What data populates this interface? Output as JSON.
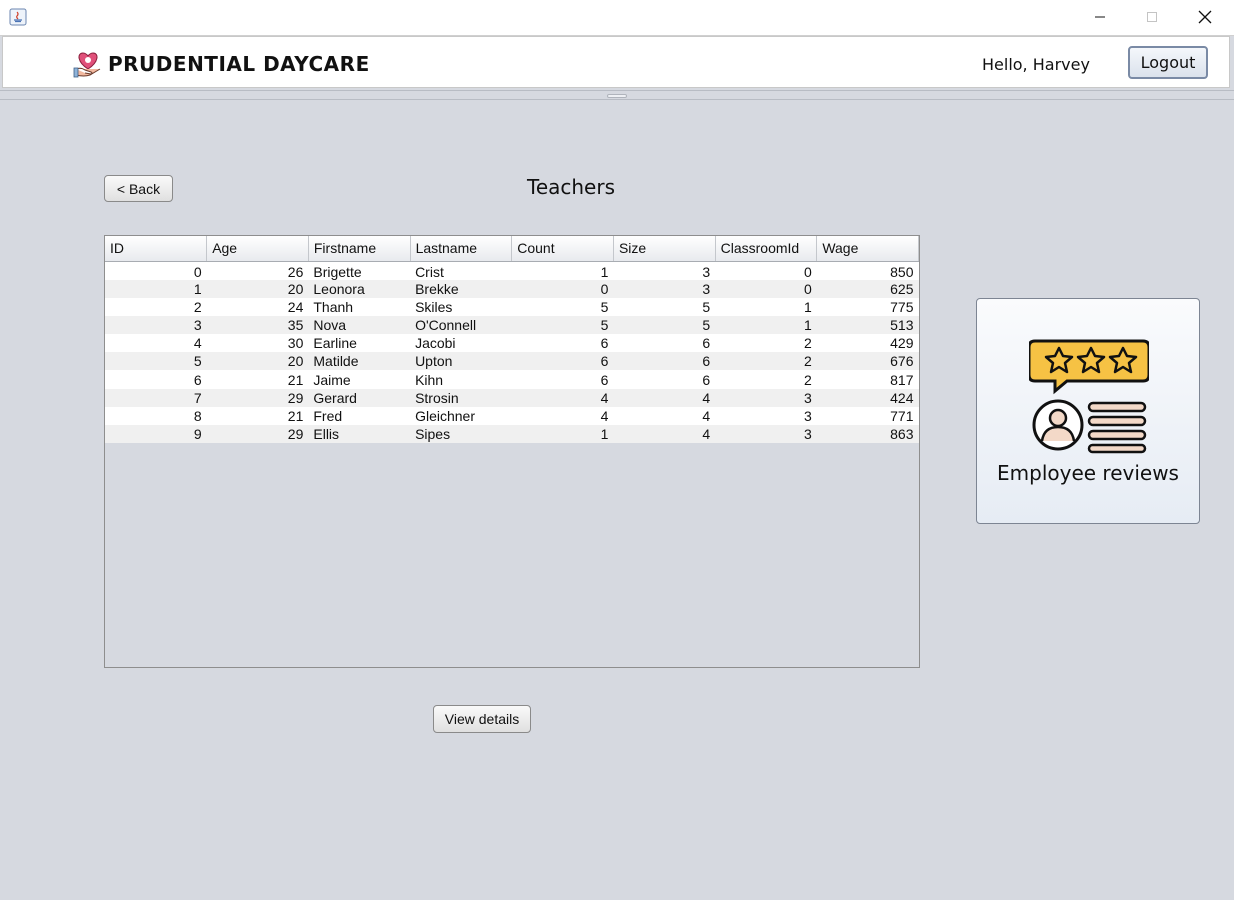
{
  "window": {
    "controls": [
      "minimize-icon",
      "maximize-icon",
      "close-icon"
    ]
  },
  "header": {
    "brand": "PRUDENTIAL DAYCARE",
    "greeting": "Hello, Harvey",
    "logout_label": "Logout"
  },
  "page": {
    "back_label": "< Back",
    "title": "Teachers",
    "view_details_label": "View details"
  },
  "table": {
    "columns": [
      "ID",
      "Age",
      "Firstname",
      "Lastname",
      "Count",
      "Size",
      "ClassroomId",
      "Wage"
    ],
    "rows": [
      [
        "0",
        "26",
        "Brigette",
        "Crist",
        "1",
        "3",
        "0",
        "850"
      ],
      [
        "1",
        "20",
        "Leonora",
        "Brekke",
        "0",
        "3",
        "0",
        "625"
      ],
      [
        "2",
        "24",
        "Thanh",
        "Skiles",
        "5",
        "5",
        "1",
        "775"
      ],
      [
        "3",
        "35",
        "Nova",
        "O'Connell",
        "5",
        "5",
        "1",
        "513"
      ],
      [
        "4",
        "30",
        "Earline",
        "Jacobi",
        "6",
        "6",
        "2",
        "429"
      ],
      [
        "5",
        "20",
        "Matilde",
        "Upton",
        "6",
        "6",
        "2",
        "676"
      ],
      [
        "6",
        "21",
        "Jaime",
        "Kihn",
        "6",
        "6",
        "2",
        "817"
      ],
      [
        "7",
        "29",
        "Gerard",
        "Strosin",
        "4",
        "4",
        "3",
        "424"
      ],
      [
        "8",
        "21",
        "Fred",
        "Gleichner",
        "4",
        "4",
        "3",
        "771"
      ],
      [
        "9",
        "29",
        "Ellis",
        "Sipes",
        "1",
        "4",
        "3",
        "863"
      ]
    ]
  },
  "reviews_card": {
    "label": "Employee reviews",
    "icon": "employee-reviews-icon"
  },
  "colors": {
    "background": "#d6d9e0",
    "star_fill": "#f6c244",
    "logo_heart": "#e0507a"
  }
}
